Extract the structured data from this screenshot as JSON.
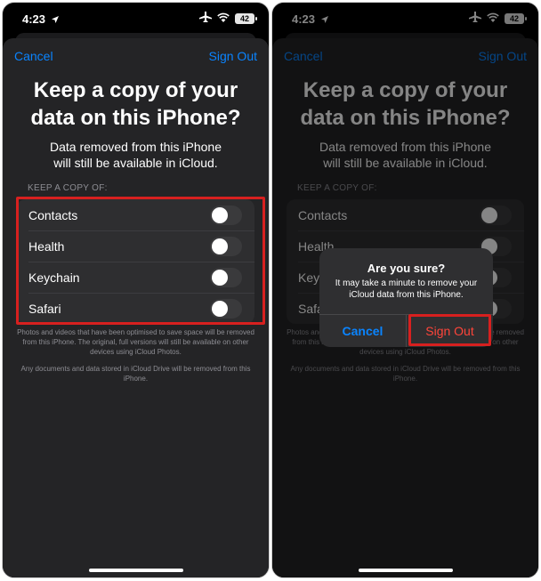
{
  "status_bar": {
    "time": "4:23",
    "battery": "42"
  },
  "sheet": {
    "cancel_label": "Cancel",
    "signout_label": "Sign Out",
    "title_line1": "Keep a copy of your",
    "title_line2": "data on this iPhone?",
    "subtitle_line1": "Data removed from this iPhone",
    "subtitle_line2": "will still be available in iCloud.",
    "section_header": "KEEP A COPY OF:",
    "items": [
      {
        "label": "Contacts",
        "on": false
      },
      {
        "label": "Health",
        "on": false
      },
      {
        "label": "Keychain",
        "on": false
      },
      {
        "label": "Safari",
        "on": false
      }
    ],
    "footer1": "Photos and videos that have been optimised to save space will be removed from this iPhone. The original, full versions will still be available on other devices using iCloud Photos.",
    "footer2": "Any documents and data stored in iCloud Drive will be removed from this iPhone."
  },
  "alert": {
    "title": "Are you sure?",
    "message": "It may take a minute to remove your iCloud data from this iPhone.",
    "cancel_label": "Cancel",
    "signout_label": "Sign Out"
  },
  "colors": {
    "accent": "#0a84ff",
    "destructive": "#ff453a",
    "highlight": "#d7201f"
  }
}
